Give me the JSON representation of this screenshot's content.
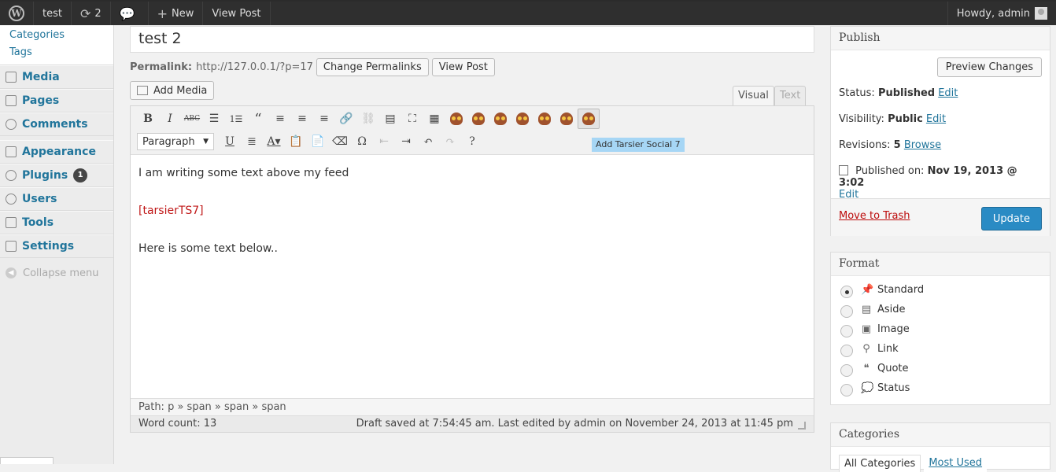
{
  "adminbar": {
    "site_name": "test",
    "updates_count": "2",
    "new_label": "New",
    "view_post_label": "View Post",
    "howdy": "Howdy, admin"
  },
  "sidebar": {
    "submenu": [
      "Categories",
      "Tags"
    ],
    "items": [
      {
        "label": "Media",
        "icon": "media-icon"
      },
      {
        "label": "Pages",
        "icon": "pages-icon"
      },
      {
        "label": "Comments",
        "icon": "comments-icon"
      },
      {
        "label": "Appearance",
        "icon": "appearance-icon"
      },
      {
        "label": "Plugins",
        "icon": "plugins-icon",
        "badge": "1"
      },
      {
        "label": "Users",
        "icon": "users-icon"
      },
      {
        "label": "Tools",
        "icon": "tools-icon"
      },
      {
        "label": "Settings",
        "icon": "settings-icon"
      }
    ],
    "collapse_label": "Collapse menu"
  },
  "post": {
    "title": "test 2",
    "permalink_label": "Permalink:",
    "permalink_url": "http://127.0.0.1/?p=17",
    "change_permalinks": "Change Permalinks",
    "view_post": "View Post",
    "add_media": "Add Media"
  },
  "editor": {
    "tabs": {
      "visual": "Visual",
      "text": "Text"
    },
    "format_select": "Paragraph",
    "tooltip": "Add Tarsier Social 7",
    "content": {
      "line1": "I am writing some text above my feed",
      "shortcode": "[tarsierTS7]",
      "line3": "Here is some text below.."
    },
    "path": "Path: p » span » span » span",
    "word_count": "Word count: 13",
    "draft_status": "Draft saved at 7:54:45 am. Last edited by admin on November 24, 2013 at 11:45 pm"
  },
  "publish": {
    "title": "Publish",
    "preview_changes": "Preview Changes",
    "status_label": "Status:",
    "status_value": "Published",
    "visibility_label": "Visibility:",
    "visibility_value": "Public",
    "revisions_label": "Revisions:",
    "revisions_value": "5",
    "browse": "Browse",
    "published_on_label": "Published on:",
    "published_on_value": "Nov 19, 2013 @ 3:02",
    "edit": "Edit",
    "move_to_trash": "Move to Trash",
    "update": "Update"
  },
  "format": {
    "title": "Format",
    "options": [
      "Standard",
      "Aside",
      "Image",
      "Link",
      "Quote",
      "Status"
    ],
    "selected": "Standard"
  },
  "categories": {
    "title": "Categories",
    "tab_all": "All Categories",
    "tab_most_used": "Most Used"
  },
  "colors": {
    "adminbar_bg": "#2f2f2f",
    "link": "#21759b",
    "update_button": "#2a8bc4",
    "shortcode_text": "#c01818",
    "tooltip_bg": "#a6d6f5"
  }
}
